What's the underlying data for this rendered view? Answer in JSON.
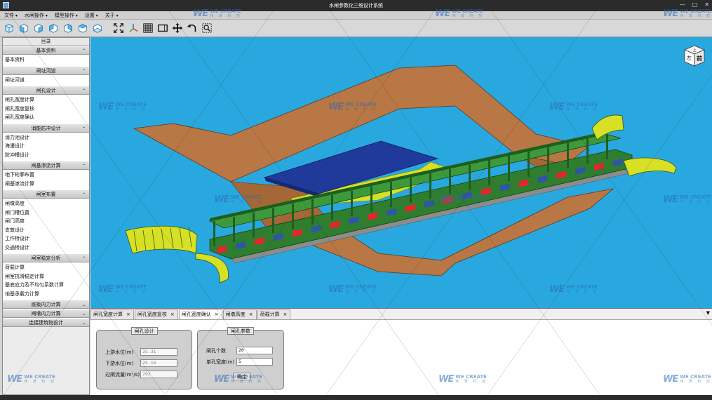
{
  "window": {
    "title": "水闸参数化三维设计系统",
    "controls": [
      "—",
      "□",
      "✕"
    ]
  },
  "menubar": [
    {
      "label": "文件"
    },
    {
      "label": "水闸操作"
    },
    {
      "label": "模型操作"
    },
    {
      "label": "设置"
    },
    {
      "label": "关于"
    }
  ],
  "toolbar": [
    {
      "name": "view-iso-icon"
    },
    {
      "name": "view-front-icon"
    },
    {
      "name": "view-back-icon"
    },
    {
      "name": "view-left-icon"
    },
    {
      "name": "view-right-icon"
    },
    {
      "name": "view-top-icon"
    },
    {
      "name": "view-bottom-icon"
    },
    {
      "name": "fit-all-icon"
    },
    {
      "name": "axis-icon"
    },
    {
      "name": "grid-icon"
    },
    {
      "name": "window-frame-icon"
    },
    {
      "name": "pan-icon"
    },
    {
      "name": "rotate-icon"
    },
    {
      "name": "zoom-window-icon"
    }
  ],
  "sidebar": {
    "title": "目录",
    "sections": [
      {
        "header": "基本资料",
        "items": [
          "基本资料"
        ]
      },
      {
        "header": "闸址河道",
        "items": [
          "闸址河道"
        ]
      },
      {
        "header": "闸孔设计",
        "items": [
          "闸孔宽度计算",
          "闸孔宽度复核",
          "闸孔宽度确认"
        ]
      },
      {
        "header": "消能防冲设计",
        "items": [
          "消力池设计",
          "海漫设计",
          "防冲槽设计"
        ]
      },
      {
        "header": "闸基渗流计算",
        "items": [
          "地下轮廓布置",
          "闸基渗流计算"
        ]
      },
      {
        "header": "闸室布置",
        "items": [
          "闸墩高度",
          "闸门槽位置",
          "闸门高度",
          "支敦设计",
          "工作桥设计",
          "交通桥设计"
        ]
      },
      {
        "header": "闸室稳定分析",
        "items": [
          "荷载计算",
          "闸室抗滑稳定计算",
          "基底应力及不均匀系数计算",
          "地基承载力计算"
        ]
      },
      {
        "header": "底板内力计算",
        "items": []
      },
      {
        "header": "闸墩内力计算",
        "items": []
      },
      {
        "header": "连接建筑物设计",
        "items": []
      }
    ]
  },
  "viewcube": {
    "top_label": "上",
    "left_label": "左",
    "front_label": "前"
  },
  "tabs": [
    {
      "label": "闸孔宽度计算",
      "active": false
    },
    {
      "label": "闸孔宽度复核",
      "active": false
    },
    {
      "label": "闸孔宽度确认",
      "active": true
    },
    {
      "label": "闸墩高度",
      "active": false
    },
    {
      "label": "荷载计算",
      "active": false
    }
  ],
  "form": {
    "group1": {
      "title": "闸孔设计",
      "upstream_label": "上游水位(m)",
      "upstream_value": "25.31",
      "downstream_label": "下游水位(m)",
      "downstream_value": "25.16",
      "discharge_label": "过闸流量(m³/s)",
      "discharge_value": "293"
    },
    "group2": {
      "title": "闸孔参数",
      "count_label": "闸孔个数",
      "count_value": "20",
      "width_label": "单孔宽度(m)",
      "width_value": "5",
      "ok_label": "确定"
    }
  },
  "watermark": {
    "en": "WE CREATE",
    "cn": "伟 景 科 技",
    "mark": "WE"
  },
  "colors": {
    "viewport_bg": "#29a8df",
    "earthwork": "#b87744",
    "structure_green": "#2f7d2f",
    "gate_red": "#e8242c",
    "pier_blue": "#2e55a8",
    "bridge_blue": "#1f3a9a",
    "wing_yellow": "#d7e024",
    "floor_gray": "#8c8c8c"
  }
}
